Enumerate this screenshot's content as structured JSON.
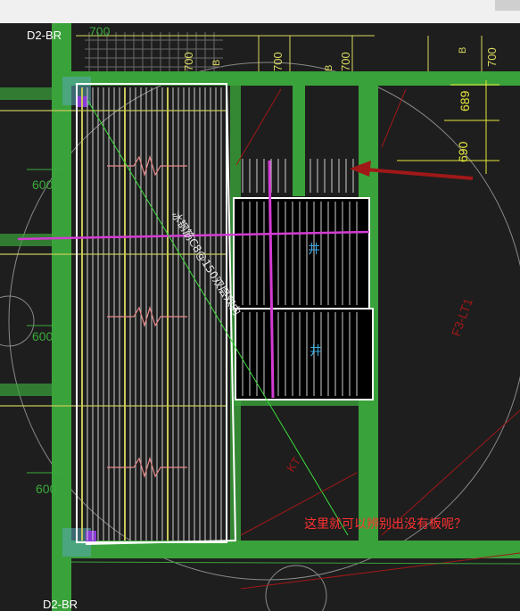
{
  "toolbar": {
    "corner": ""
  },
  "labels": {
    "axis_top": "D2-BR",
    "axis_bottom": "D2-BR",
    "dim_700_a": "700",
    "dim_700_b": "700",
    "dim_700_c": "700",
    "dim_700_d": "700",
    "dim_700_e": "700",
    "dim_600_a": "600",
    "dim_600_b": "600",
    "dim_600_c": "600",
    "dim_689": "689",
    "dim_690": "690",
    "b_a": "B",
    "b_b": "B",
    "b_c": "B",
    "rebar_note": "冰钢筋C8@150双层双向",
    "well_1": "井",
    "well_2": "井",
    "beam_f3": "F3-LT1",
    "beam_kt": "KT",
    "question": "这里就可以辨别出没有板呢？"
  },
  "colors": {
    "background": "#1e1e1e",
    "beam_green": "#3aa23a",
    "beam_light": "#7cd87c",
    "slab_outline": "#ffffff",
    "rebar_yellow": "#c8c85a",
    "magenta": "#d43cd4",
    "cyan_text": "#3aa8e0",
    "red_text": "#ff3030",
    "red_line": "#a01818",
    "dim_yellow": "#e6e63c",
    "dim_green": "#3aaa3a",
    "grey_grid": "#8a8a8a"
  }
}
